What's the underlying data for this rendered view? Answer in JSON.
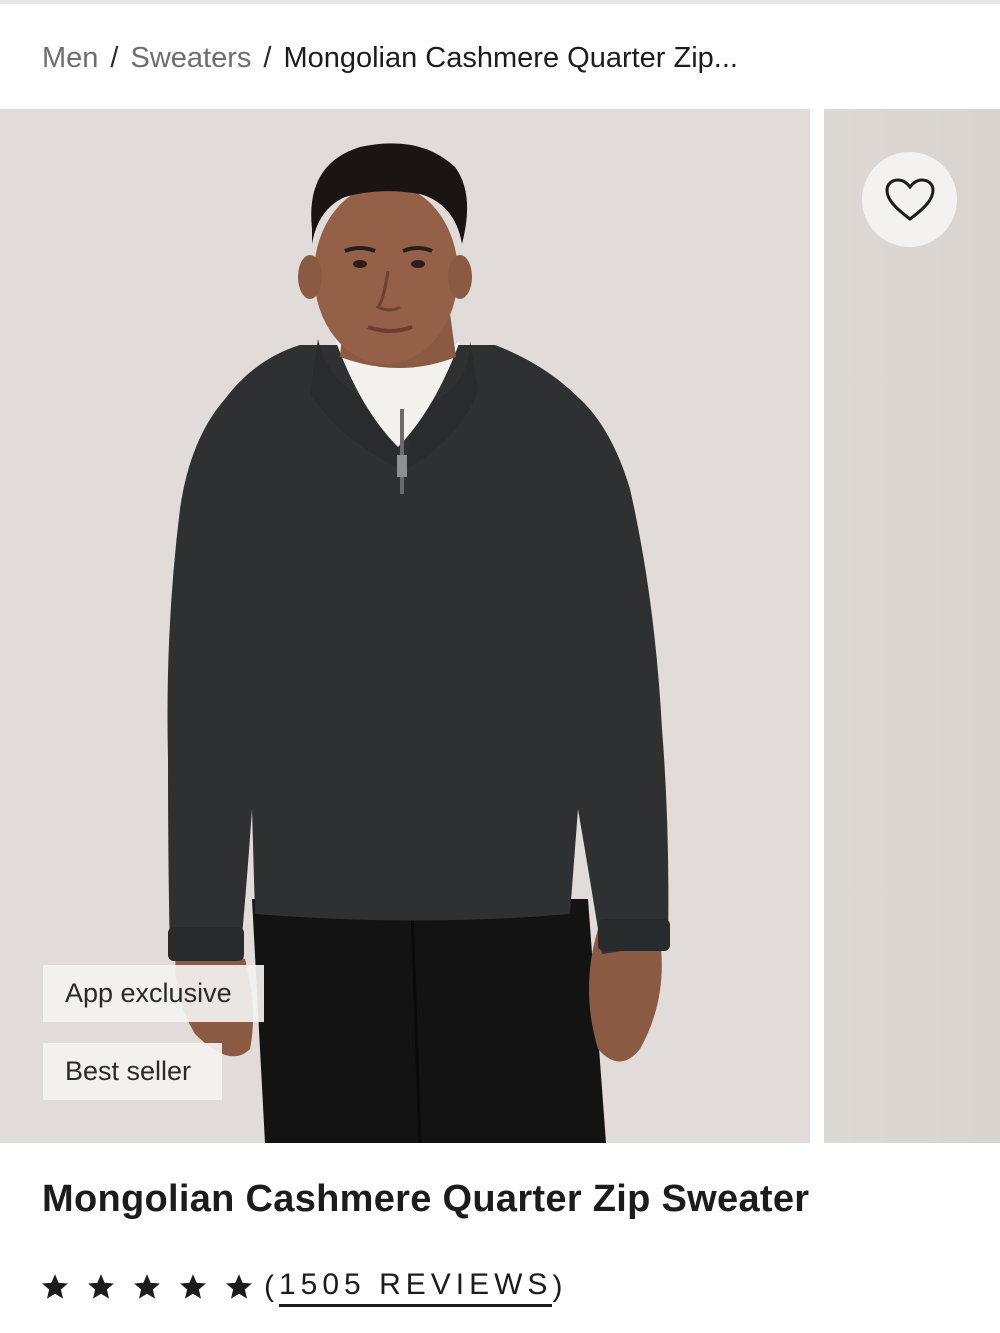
{
  "breadcrumb": {
    "items": [
      "Men",
      "Sweaters"
    ],
    "separator": "/",
    "current": "Mongolian Cashmere Quarter Zip..."
  },
  "gallery": {
    "favorite_icon": "heart-outline-icon",
    "badges": [
      "App exclusive",
      "Best seller"
    ]
  },
  "product": {
    "title": "Mongolian Cashmere Quarter Zip Sweater",
    "rating": {
      "stars": 5,
      "max": 5,
      "star_icon": "star-filled-icon"
    },
    "reviews_open": "(",
    "reviews_label": "1505 REVIEWS",
    "reviews_close": ")"
  },
  "colors": {
    "background": "#ffffff",
    "photo_background": "#e1dcd9",
    "sweater": "#2f3031",
    "text": "#1c1c1c",
    "muted_text": "#6e6e6e"
  }
}
